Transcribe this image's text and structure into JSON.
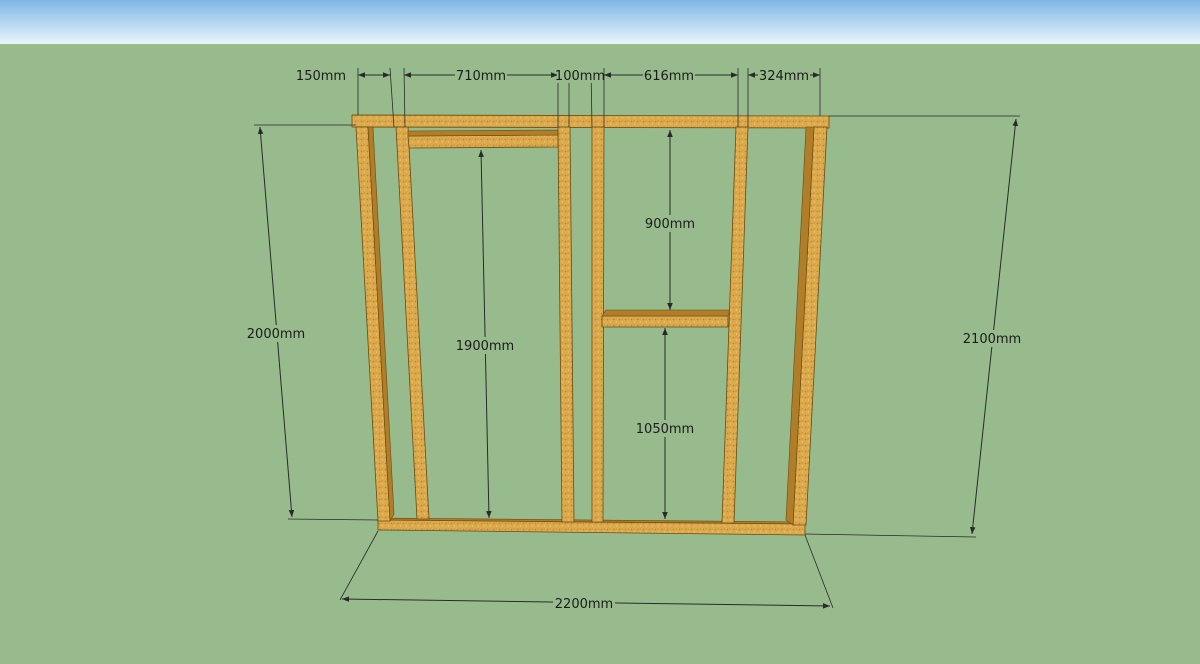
{
  "scene": {
    "sky_color": "#bfdff2",
    "ground_color": "#97bb8d",
    "wood_color": "#d9a445",
    "dimension_color": "#2a2a2a"
  },
  "dimensions": {
    "top_150": "150mm",
    "top_710": "710mm",
    "top_100": "100mm",
    "top_616": "616mm",
    "top_324": "324mm",
    "height_900": "900mm",
    "height_1900": "1900mm",
    "height_1050": "1050mm",
    "left_2000": "2000mm",
    "right_2100": "2100mm",
    "bottom_2200": "2200mm"
  }
}
